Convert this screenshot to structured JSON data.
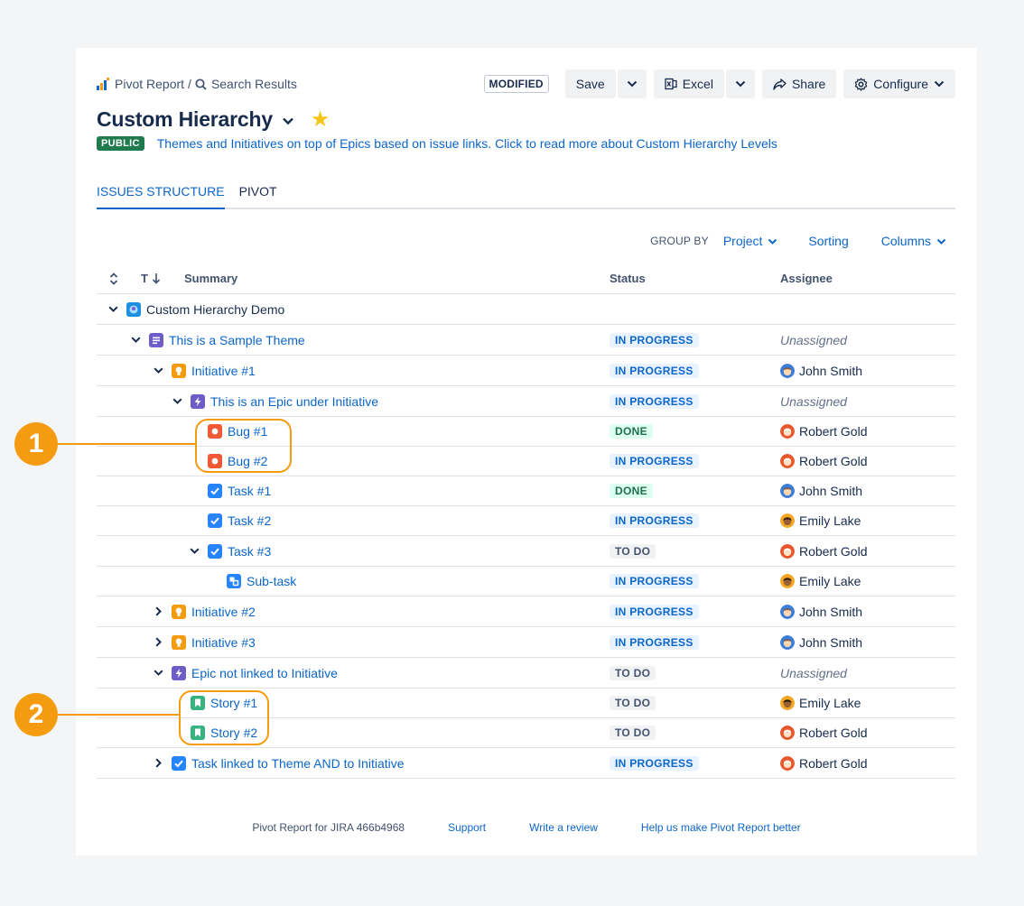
{
  "breadcrumb": {
    "root": "Pivot Report",
    "separator": "/",
    "current": "Search Results",
    "root_icon": "pivot-logo-icon",
    "current_icon": "search-icon"
  },
  "toolbar": {
    "modified_badge": "MODIFIED",
    "save_label": "Save",
    "excel_label": "Excel",
    "share_label": "Share",
    "configure_label": "Configure"
  },
  "page": {
    "title": "Custom Hierarchy",
    "visibility_badge": "PUBLIC",
    "description": "Themes and Initiatives on top of Epics based on issue links. Click to read more about Custom Hierarchy Levels"
  },
  "tabs": [
    {
      "label": "ISSUES STRUCTURE",
      "active": true
    },
    {
      "label": "PIVOT",
      "active": false
    }
  ],
  "groupby": {
    "label": "GROUP BY",
    "project": "Project",
    "sorting": "Sorting",
    "columns": "Columns"
  },
  "table": {
    "headers": {
      "t": "T",
      "summary": "Summary",
      "status": "Status",
      "assignee": "Assignee"
    },
    "rows": [
      {
        "level": 0,
        "chevron": "down",
        "icon": "project-icon",
        "summary": "Custom Hierarchy Demo",
        "link": false,
        "status": "",
        "status_type": "",
        "assignee": "",
        "avatar": ""
      },
      {
        "level": 1,
        "chevron": "down",
        "icon": "theme-icon",
        "summary": "This is a Sample Theme",
        "link": true,
        "status": "IN PROGRESS",
        "status_type": "progress",
        "assignee": "Unassigned",
        "avatar": ""
      },
      {
        "level": 2,
        "chevron": "down",
        "icon": "initiative-icon",
        "summary": "Initiative #1",
        "link": true,
        "status": "IN PROGRESS",
        "status_type": "progress",
        "assignee": "John Smith",
        "avatar": "john"
      },
      {
        "level": 3,
        "chevron": "down",
        "icon": "epic-icon",
        "summary": "This is an Epic under Initiative",
        "link": true,
        "status": "IN PROGRESS",
        "status_type": "progress",
        "assignee": "Unassigned",
        "avatar": ""
      },
      {
        "level": 4,
        "chevron": "none",
        "icon": "bug-icon",
        "summary": "Bug #1",
        "link": true,
        "status": "DONE",
        "status_type": "done",
        "assignee": "Robert Gold",
        "avatar": "robert"
      },
      {
        "level": 4,
        "chevron": "none",
        "icon": "bug-icon",
        "summary": "Bug #2",
        "link": true,
        "status": "IN PROGRESS",
        "status_type": "progress",
        "assignee": "Robert Gold",
        "avatar": "robert"
      },
      {
        "level": 4,
        "chevron": "none",
        "icon": "task-icon",
        "summary": "Task #1",
        "link": true,
        "status": "DONE",
        "status_type": "done",
        "assignee": "John Smith",
        "avatar": "john"
      },
      {
        "level": 4,
        "chevron": "none",
        "icon": "task-icon",
        "summary": "Task #2",
        "link": true,
        "status": "IN PROGRESS",
        "status_type": "progress",
        "assignee": "Emily Lake",
        "avatar": "emily"
      },
      {
        "level": 4,
        "chevron": "down",
        "icon": "task-icon",
        "summary": "Task #3",
        "link": true,
        "status": "TO DO",
        "status_type": "todo",
        "assignee": "Robert Gold",
        "avatar": "robert"
      },
      {
        "level": 5,
        "chevron": "none",
        "icon": "subtask-icon",
        "summary": "Sub-task",
        "link": true,
        "status": "IN PROGRESS",
        "status_type": "progress",
        "assignee": "Emily Lake",
        "avatar": "emily"
      },
      {
        "level": 2,
        "chevron": "right",
        "icon": "initiative-icon",
        "summary": "Initiative #2",
        "link": true,
        "status": "IN PROGRESS",
        "status_type": "progress",
        "assignee": "John Smith",
        "avatar": "john"
      },
      {
        "level": 2,
        "chevron": "right",
        "icon": "initiative-icon",
        "summary": "Initiative #3",
        "link": true,
        "status": "IN PROGRESS",
        "status_type": "progress",
        "assignee": "John Smith",
        "avatar": "john"
      },
      {
        "level": 2,
        "chevron": "down",
        "icon": "epic-icon",
        "summary": "Epic not linked to Initiative",
        "link": true,
        "status": "TO DO",
        "status_type": "todo",
        "assignee": "Unassigned",
        "avatar": ""
      },
      {
        "level": 3,
        "chevron": "none",
        "icon": "story-icon",
        "summary": "Story #1",
        "link": true,
        "status": "TO DO",
        "status_type": "todo",
        "assignee": "Emily Lake",
        "avatar": "emily"
      },
      {
        "level": 3,
        "chevron": "none",
        "icon": "story-icon",
        "summary": "Story #2",
        "link": true,
        "status": "TO DO",
        "status_type": "todo",
        "assignee": "Robert Gold",
        "avatar": "robert"
      },
      {
        "level": 2,
        "chevron": "right",
        "icon": "task-icon",
        "summary": "Task linked to Theme AND to Initiative",
        "link": true,
        "status": "IN PROGRESS",
        "status_type": "progress",
        "assignee": "Robert Gold",
        "avatar": "robert"
      }
    ]
  },
  "footer": {
    "version": "Pivot Report for JIRA 466b4968",
    "support": "Support",
    "review": "Write a review",
    "feedback": "Help us make Pivot Report better"
  },
  "callouts": [
    "1",
    "2"
  ],
  "colors": {
    "accent": "#0c66c9",
    "callout": "#f49b0f",
    "public": "#1f7a4d"
  }
}
